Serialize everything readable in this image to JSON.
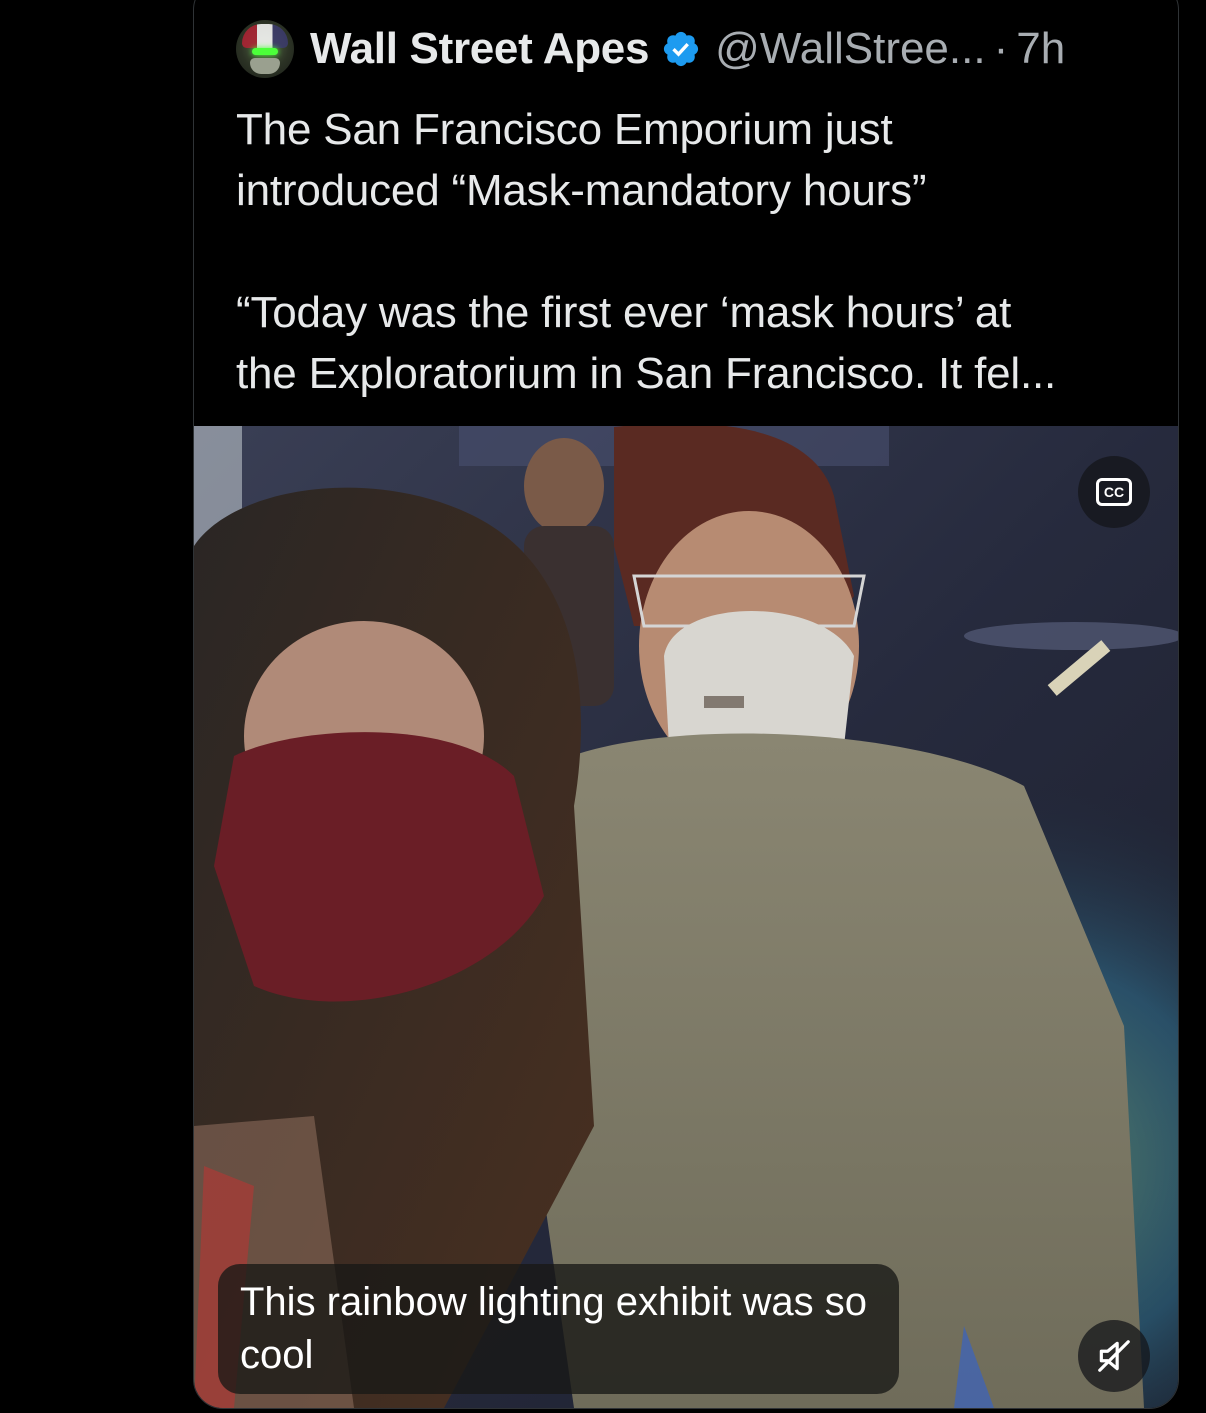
{
  "post": {
    "author": {
      "display_name": "Wall Street Apes",
      "handle": "@WallStree...",
      "separator": "·",
      "time": "7h",
      "verified": true,
      "avatar_icon": "ape-helmet-avatar-icon"
    },
    "text_lines": [
      "The San Francisco Emporium just",
      "introduced “Mask-mandatory hours”",
      "“Today was the first ever ‘mask hours’ at",
      "the Exploratorium in San Francisco. It fel..."
    ],
    "media": {
      "type": "video",
      "caption": "This rainbow lighting exhibit was so cool",
      "cc_icon": "closed-captions-icon",
      "mute_icon": "muted-speaker-icon"
    }
  },
  "colors": {
    "background": "#000000",
    "text_primary": "#e7e9ea",
    "text_secondary": "#a8adb2",
    "verified_badge": "#1d9bf0",
    "card_border": "#2f3336"
  }
}
